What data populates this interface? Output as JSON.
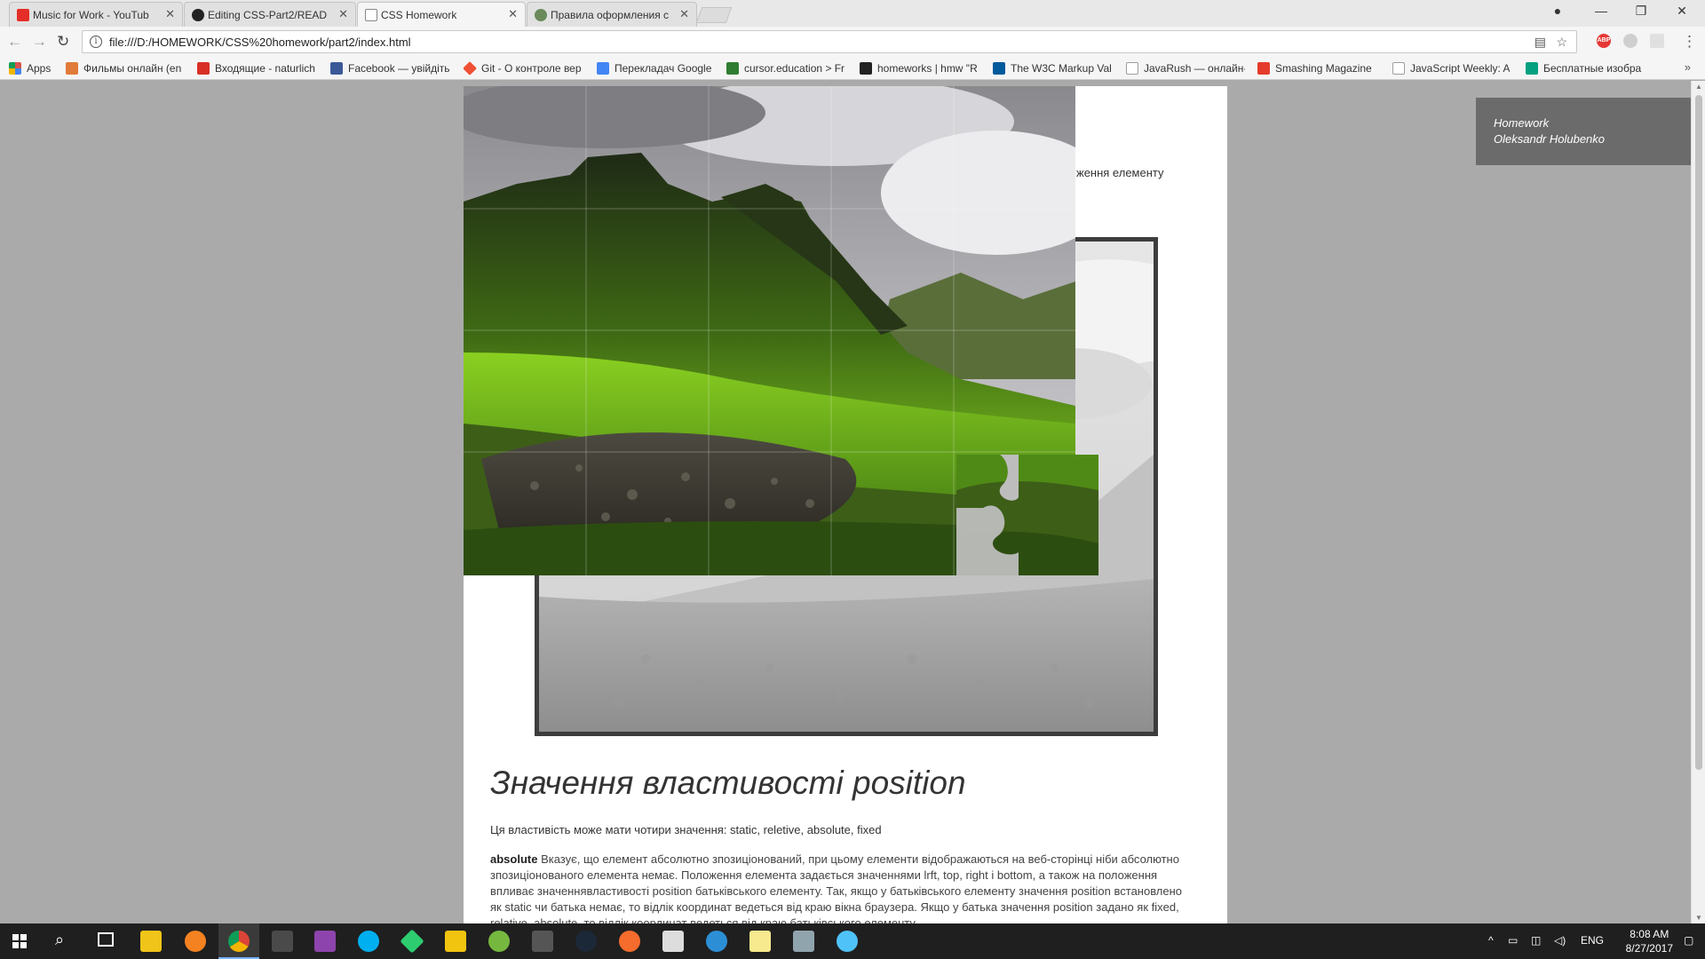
{
  "browser": {
    "tabs": [
      {
        "title": "Music for Work - YouTub",
        "favicon_color": "#e52d27",
        "active": false
      },
      {
        "title": "Editing CSS-Part2/READ",
        "favicon_color": "#222222",
        "active": false
      },
      {
        "title": "CSS Homework",
        "favicon_color": "#888888",
        "active": true
      },
      {
        "title": "Правила оформления с",
        "favicon_color": "#6a8a5a",
        "active": false
      }
    ],
    "address": "file:///D:/HOMEWORK/CSS%20homework/part2/index.html",
    "extension_abp": "ABP",
    "bookmarks": [
      {
        "label": "Apps",
        "color": "#d9534f"
      },
      {
        "label": "Фильмы онлайн (en",
        "color": "#e07b39"
      },
      {
        "label": "Входящие - naturlich",
        "color": "#d93025"
      },
      {
        "label": "Facebook — увійдіть",
        "color": "#3b5998"
      },
      {
        "label": "Git - О контроле вер",
        "color": "#f05033"
      },
      {
        "label": "Перекладач Google",
        "color": "#4285f4"
      },
      {
        "label": "cursor.education > Fr",
        "color": "#2e7d32"
      },
      {
        "label": "homeworks | hmw \"R",
        "color": "#222222"
      },
      {
        "label": "The W3C Markup Val",
        "color": "#005a9c"
      },
      {
        "label": "JavaRush — онлайн-",
        "color": "#9e9e9e"
      },
      {
        "label": "Smashing Magazine",
        "color": "#e53b2c"
      },
      {
        "label": "JavaScript Weekly: A",
        "color": "#9e9e9e"
      },
      {
        "label": "Бесплатные изобра",
        "color": "#05a081"
      }
    ],
    "bookmarks_more": "»"
  },
  "page": {
    "partial_text": "ження елементу",
    "heading": "Значення властивості position",
    "intro": "Ця властивість може мати чотири значення: static, reletive, absolute, fixed",
    "absolute_term": "absolute",
    "absolute_text": " Вказує, що елемент абсолютно зпозиціонований, при цьому елементи відображаються на веб-сторінці ніби абсолютно зпозиціонованого елемента немає. Положення елемента задається значеннями lrft, top, right і bottom, а також на положення впливає значеннявластивості position батьківського елементу. Так, якщо у батьківського елементу значення position встановлено як static чи батька немає, то відлік координат ведеться від краю вікна браузера. Якщо у батька значення position задано як fixed, relative, absolute, то відлік координат ведеться від краю батьківського елементу.",
    "fixed_note": {
      "line1": "Homework",
      "line2": "Oleksandr Holubenko"
    }
  },
  "taskbar": {
    "language": "ENG",
    "time": "8:08 AM",
    "date": "8/27/2017",
    "apps": [
      {
        "name": "search-app",
        "color": "#1f1f1f"
      },
      {
        "name": "task-view",
        "color": "#1f1f1f"
      },
      {
        "name": "file-explorer",
        "color": "#f0c419"
      },
      {
        "name": "avast",
        "color": "#f58220"
      },
      {
        "name": "chrome",
        "color": "#db4437"
      },
      {
        "name": "sublime-text",
        "color": "#4a4a4a"
      },
      {
        "name": "app-s",
        "color": "#8e44ad"
      },
      {
        "name": "skype",
        "color": "#00aff0"
      },
      {
        "name": "sourcetree",
        "color": "#2ecc71"
      },
      {
        "name": "sticky-app",
        "color": "#f1c40f"
      },
      {
        "name": "utorrent",
        "color": "#76b83f"
      },
      {
        "name": "app-grid",
        "color": "#555555"
      },
      {
        "name": "steam",
        "color": "#1b2838"
      },
      {
        "name": "origin",
        "color": "#f56c2d"
      },
      {
        "name": "notepad-app",
        "color": "#dddddd"
      },
      {
        "name": "app-blue",
        "color": "#2c8fd6"
      },
      {
        "name": "sticky-notes",
        "color": "#f7e98d"
      },
      {
        "name": "calculator",
        "color": "#90a4ae"
      },
      {
        "name": "paint",
        "color": "#4fc3f7"
      }
    ]
  }
}
